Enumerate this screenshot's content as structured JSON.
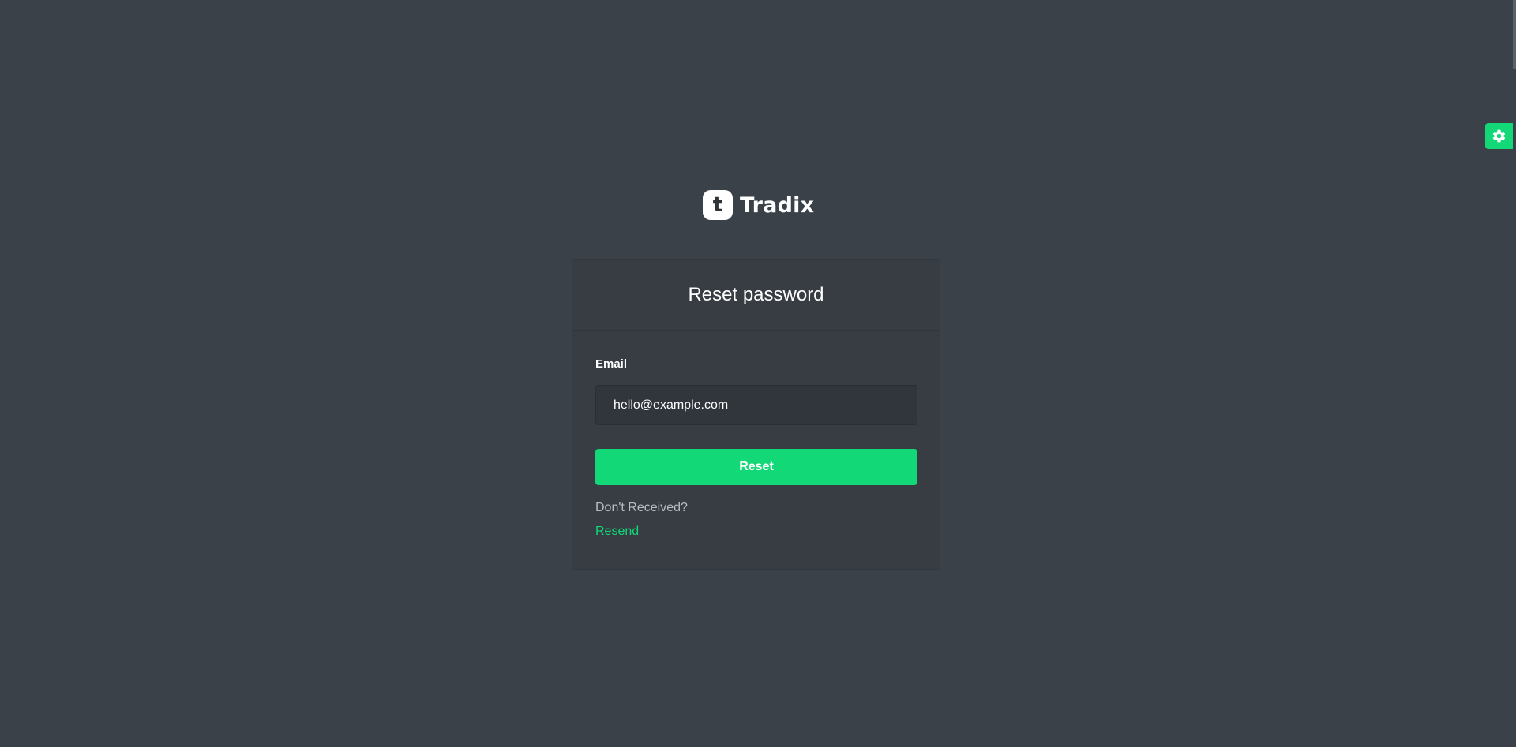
{
  "brand": {
    "logo_letter": "t",
    "name": "Tradix"
  },
  "card": {
    "title": "Reset password",
    "email_label": "Email",
    "email_value": "hello@example.com",
    "reset_label": "Reset",
    "helper_text": "Don't Received?",
    "resend_label": "Resend"
  },
  "settings": {
    "icon": "gear-icon"
  },
  "colors": {
    "background": "#3a4148",
    "card": "#373d43",
    "accent": "#13d878",
    "input": "#30363b"
  }
}
